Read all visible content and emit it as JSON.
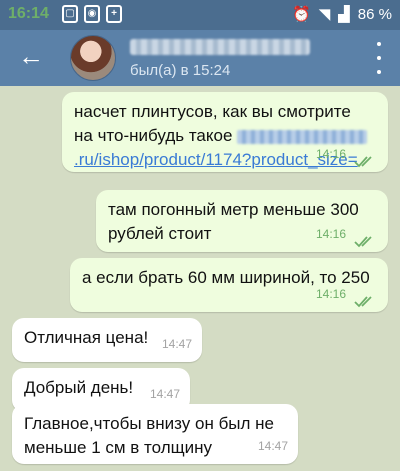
{
  "status_bar": {
    "time": "16:14",
    "battery": "86 %"
  },
  "header": {
    "last_seen": "был(а) в 15:24"
  },
  "messages": [
    {
      "direction": "out",
      "line1": "насчет плинтусов, как вы смотрите",
      "line2": "на что-нибудь такое",
      "link": ".ru/ishop/product/1174?product_size=",
      "time": "14:16"
    },
    {
      "direction": "out",
      "line1": "там погонный метр меньше 300",
      "line2": "рублей стоит",
      "time": "14:16"
    },
    {
      "direction": "out",
      "line1": "а если брать 60 мм шириной, то 250",
      "time": "14:16"
    },
    {
      "direction": "in",
      "line1": "Отличная цена!",
      "time": "14:47"
    },
    {
      "direction": "in",
      "line1": "Добрый день!",
      "time": "14:47"
    },
    {
      "direction": "in",
      "line1": "Главное,чтобы внизу он был не",
      "line2": "меньше 1 см в толщину",
      "time": "14:47"
    }
  ]
}
